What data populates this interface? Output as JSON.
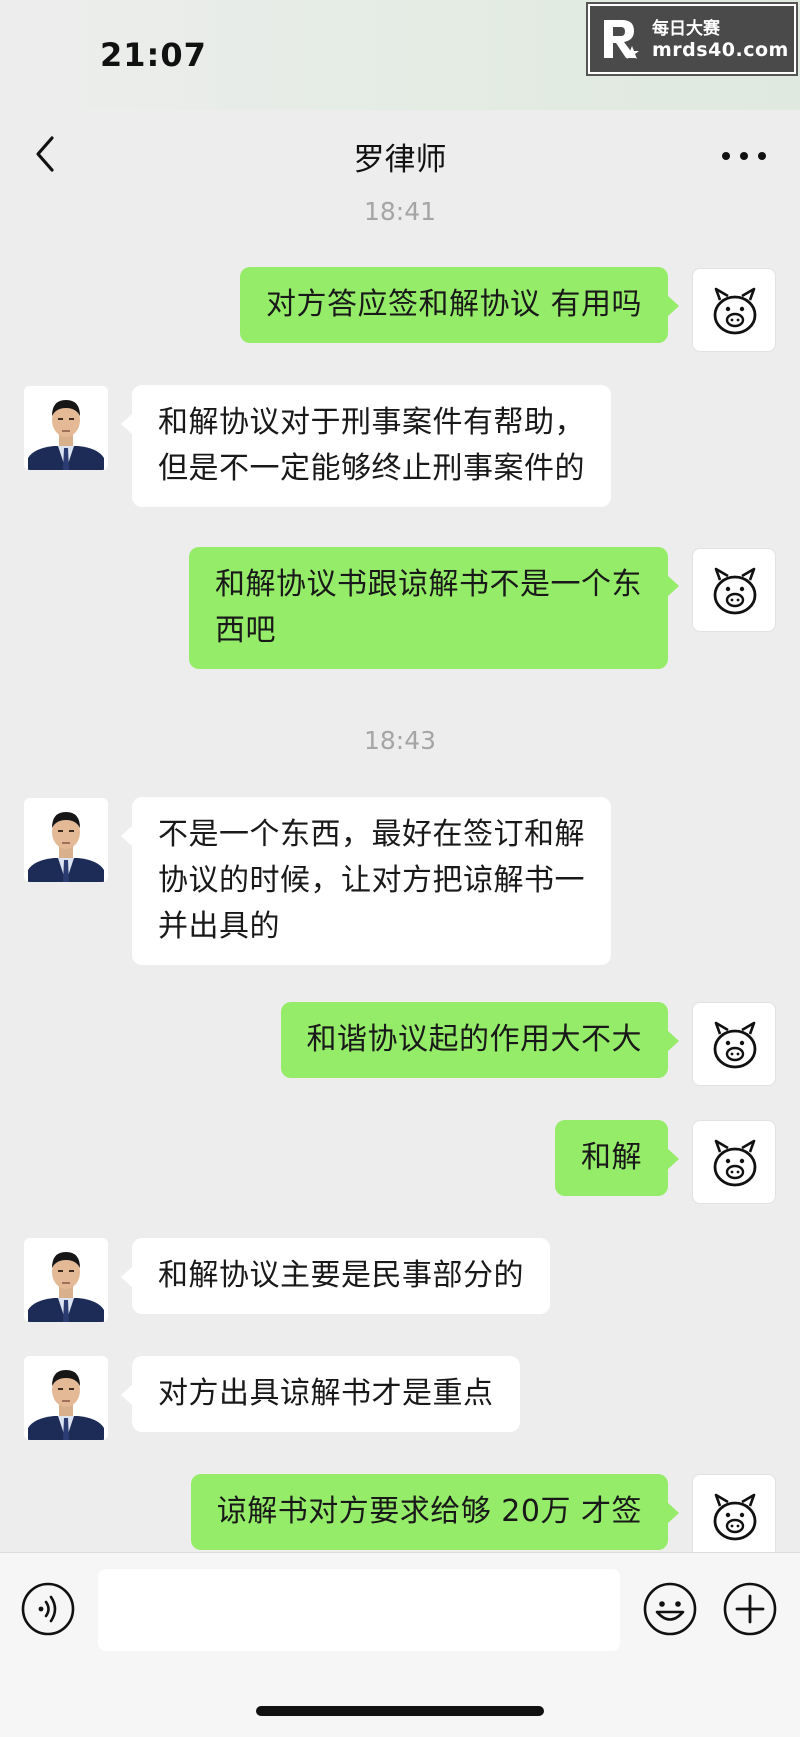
{
  "status_bar": {
    "time": "21:07"
  },
  "watermark": {
    "line1": "每日大赛",
    "line2": "mrds40.com"
  },
  "header": {
    "title": "罗律师",
    "back_icon": "chevron-left-icon",
    "more_icon": "more-dots-icon"
  },
  "chat": {
    "timestamps": [
      "18:41",
      "18:43"
    ],
    "messages": [
      {
        "sender": "me",
        "text": "对方答应签和解协议 有用吗"
      },
      {
        "sender": "lawyer",
        "text": "和解协议对于刑事案件有帮助，\n但是不一定能够终止刑事案件的"
      },
      {
        "sender": "me",
        "text": "和解协议书跟谅解书不是一个东\n西吧"
      },
      {
        "sender": "lawyer",
        "text": "不是一个东西，最好在签订和解\n协议的时候，让对方把谅解书一\n并出具的"
      },
      {
        "sender": "me",
        "text": "和谐协议起的作用大不大"
      },
      {
        "sender": "me",
        "text": "和解"
      },
      {
        "sender": "lawyer",
        "text": "和解协议主要是民事部分的"
      },
      {
        "sender": "lawyer",
        "text": "对方出具谅解书才是重点"
      },
      {
        "sender": "me",
        "text": "谅解书对方要求给够 20万 才签"
      }
    ]
  },
  "input_bar": {
    "value": "",
    "voice_icon": "voice-icon",
    "emoji_icon": "emoji-icon",
    "plus_icon": "plus-icon"
  },
  "colors": {
    "background": "#ededed",
    "my_bubble": "#95ec69",
    "their_bubble": "#ffffff",
    "timestamp_text": "#a5a5a5"
  }
}
